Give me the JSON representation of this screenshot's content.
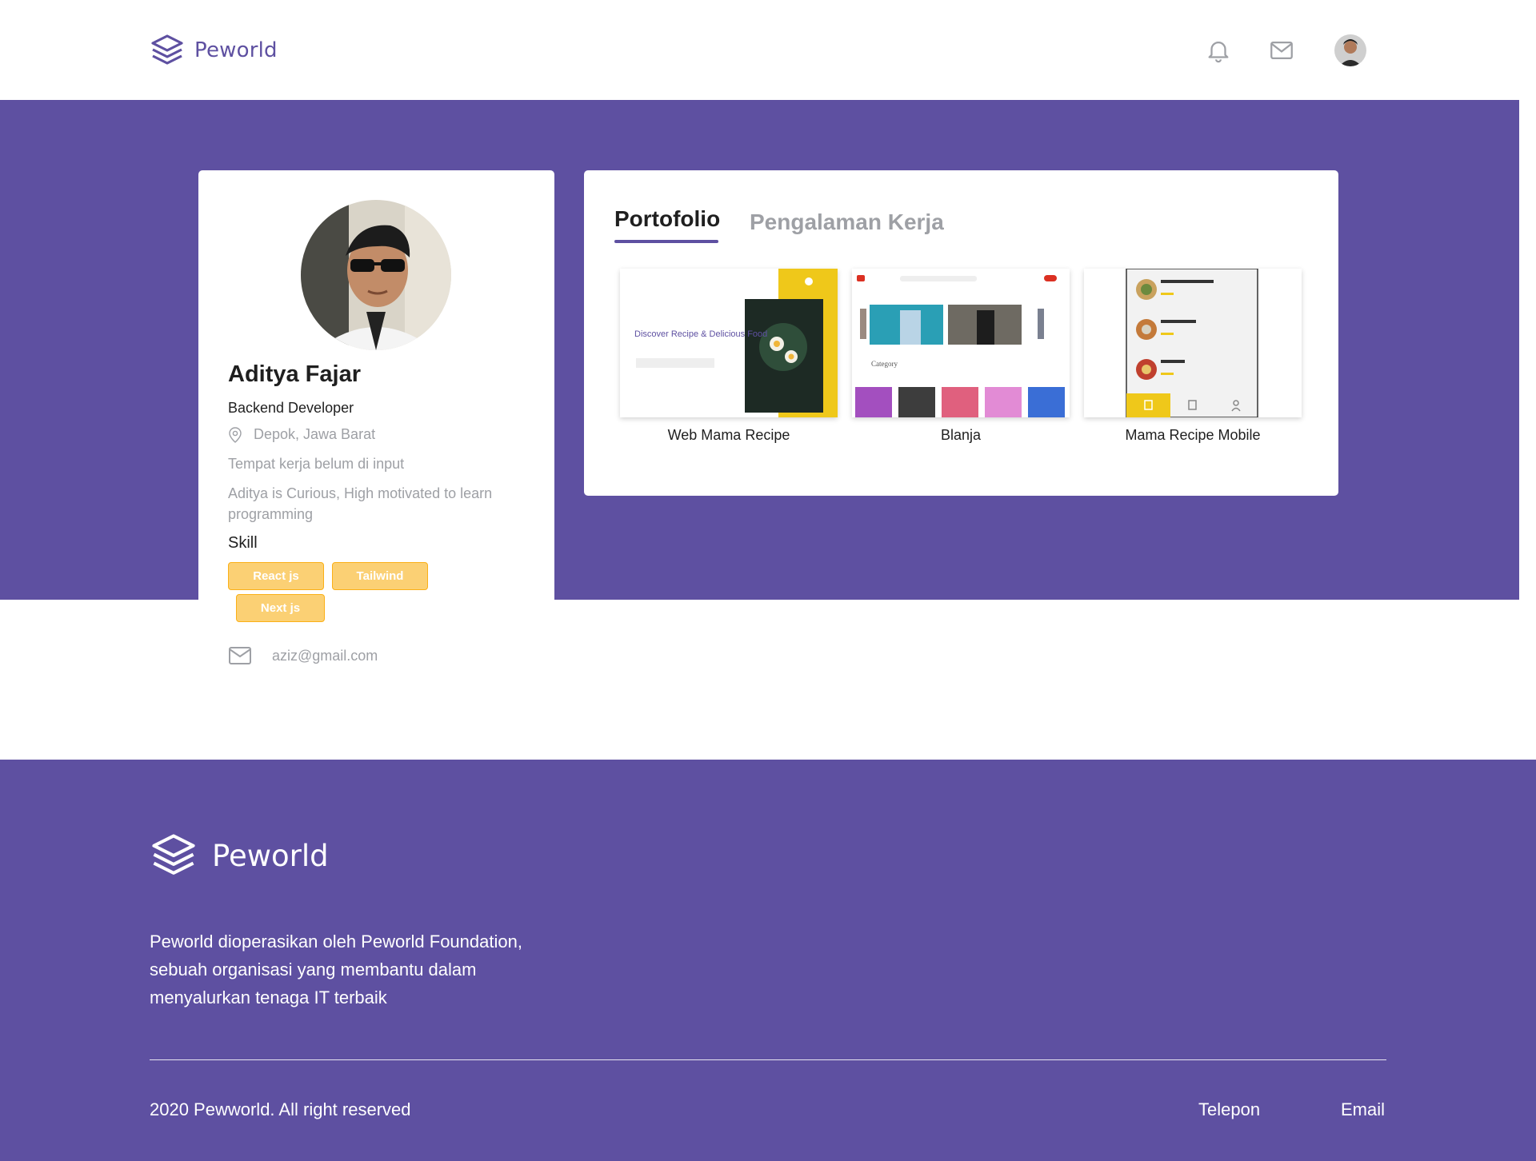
{
  "navbar": {
    "brand": "Peworld",
    "icons": [
      "bell-icon",
      "mail-icon"
    ],
    "avatar": "user-avatar"
  },
  "profile": {
    "name": "Aditya Fajar",
    "role": "Backend Developer",
    "location": "Depok, Jawa Barat",
    "workplace": "Tempat kerja belum di input",
    "bio": "Aditya is Curious, High motivated to learn programming",
    "skill_title": "Skill",
    "skills": [
      "React js",
      "Tailwind",
      "Next js"
    ],
    "email": "aziz@gmail.com"
  },
  "tabs": {
    "portfolio": "Portofolio",
    "experience": "Pengalaman Kerja",
    "active": "Portofolio"
  },
  "portfolio": [
    {
      "title": "Web Mama Recipe",
      "thumb_text": "Discover Recipe & Delicious Food"
    },
    {
      "title": "Blanja",
      "thumb_text": "Category"
    },
    {
      "title": "Mama Recipe Mobile",
      "thumb_text": ""
    }
  ],
  "footer": {
    "brand": "Peworld",
    "description": "Peworld dioperasikan oleh Peworld Foundation, sebuah organisasi yang membantu dalam menyalurkan tenaga IT terbaik",
    "copyright": "2020 Pewworld. All right reserved",
    "links": [
      "Telepon",
      "Email"
    ]
  },
  "colors": {
    "primary": "#5e50a1",
    "skill_bg": "#fbd074",
    "muted_text": "#9ea0a5"
  }
}
